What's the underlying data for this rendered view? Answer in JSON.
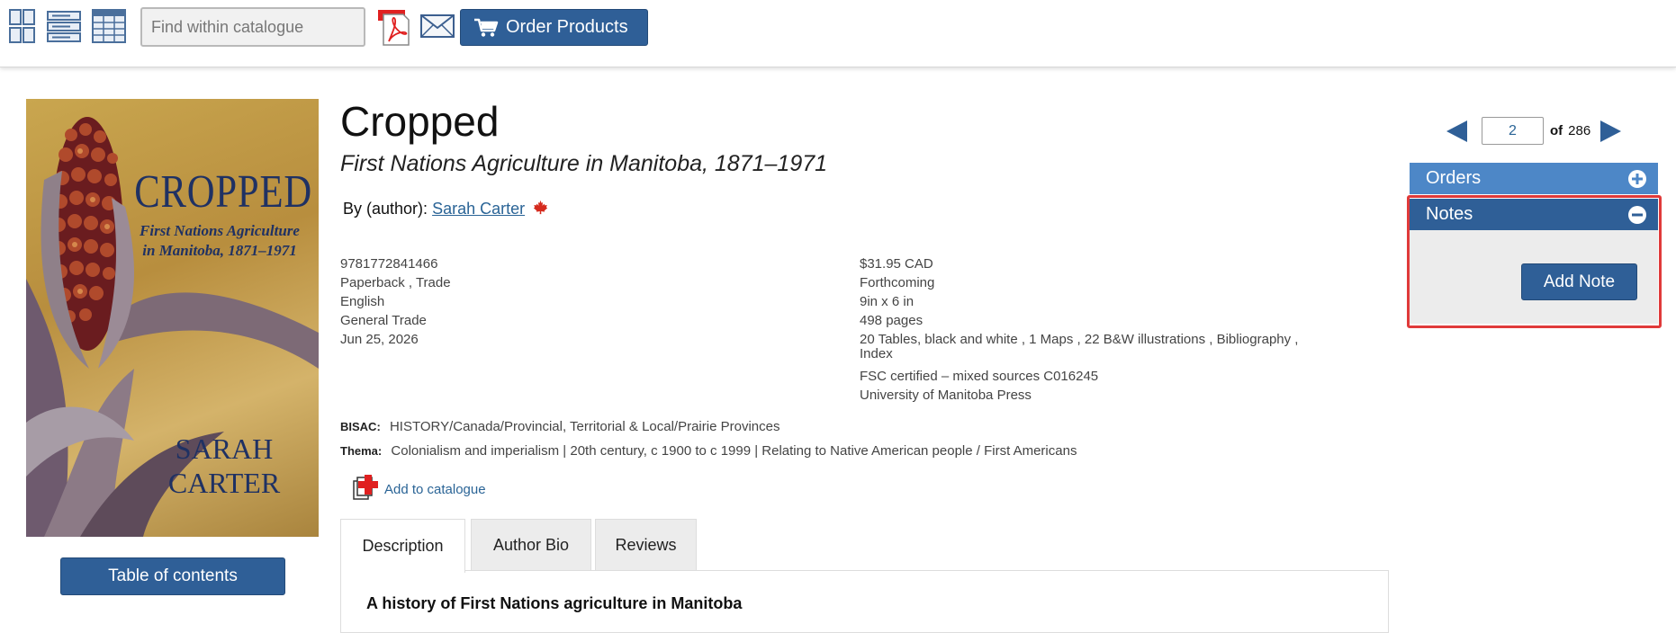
{
  "toolbar": {
    "search_placeholder": "Find within catalogue",
    "order_button_label": "Order Products",
    "icons": [
      "grid-view-icon",
      "list-view-icon",
      "table-view-icon",
      "pdf-icon",
      "email-icon",
      "cart-icon"
    ]
  },
  "cover": {
    "title": "CROPPED",
    "subtitle_line1": "First Nations Agriculture",
    "subtitle_line2": "in Manitoba, 1871–1971",
    "author_line1": "SARAH",
    "author_line2": "CARTER"
  },
  "toc_button_label": "Table of contents",
  "book": {
    "title": "Cropped",
    "subtitle": "First Nations Agriculture in Manitoba, 1871–1971",
    "by_label": "By (author):",
    "author": "Sarah Carter",
    "details_left": [
      "9781772841466",
      "Paperback , Trade",
      "English",
      "General Trade",
      "Jun 25, 2026"
    ],
    "price": "$31.95 CAD",
    "status": "Forthcoming",
    "dimensions": "9in x 6 in",
    "pages": "498 pages",
    "illustrations": "20 Tables, black and white , 1 Maps , 22 B&W illustrations , Bibliography , Index",
    "certification": "FSC certified – mixed sources C016245",
    "publisher": "University of Manitoba Press",
    "bisac_label": "BISAC:",
    "bisac": "HISTORY/Canada/Provincial, Territorial & Local/Prairie Provinces",
    "thema_label": "Thema:",
    "thema": "Colonialism and imperialism | 20th century, c 1900 to c 1999 | Relating to Native American people / First Americans"
  },
  "add_to_catalogue_label": "Add to catalogue",
  "tabs": {
    "description": "Description",
    "author_bio": "Author Bio",
    "reviews": "Reviews",
    "active": "Description"
  },
  "description_heading": "A history of First Nations agriculture in Manitoba",
  "pager": {
    "current": "2",
    "of_label": "of",
    "total": "286"
  },
  "side": {
    "orders_label": "Orders",
    "notes_label": "Notes",
    "add_note_label": "Add Note"
  },
  "colors": {
    "primary_button": "#2f5f97",
    "orders_header": "#4d87c7",
    "link": "#2a6496",
    "highlight": "#e03a3a",
    "maple_leaf": "#d52b1e"
  }
}
